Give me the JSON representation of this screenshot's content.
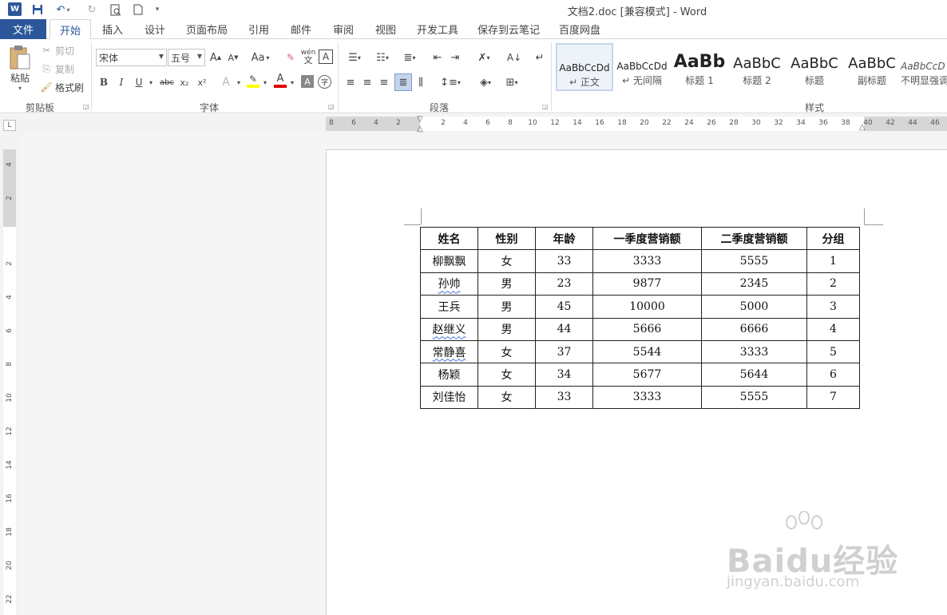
{
  "window": {
    "title": "文档2.doc [兼容模式] - Word",
    "app_logo": "W"
  },
  "quick_access": [
    "save-icon",
    "undo-icon",
    "redo-icon",
    "print-preview-icon",
    "new-doc-icon",
    "customize-icon"
  ],
  "tabs": {
    "file": "文件",
    "items": [
      "开始",
      "插入",
      "设计",
      "页面布局",
      "引用",
      "邮件",
      "审阅",
      "视图",
      "开发工具",
      "保存到云笔记",
      "百度网盘"
    ],
    "active_index": 0
  },
  "clipboard": {
    "paste": "粘贴",
    "cut": "剪切",
    "copy": "复制",
    "format_painter": "格式刷",
    "label": "剪贴板"
  },
  "font": {
    "name": "宋体",
    "size": "五号",
    "grow": "A",
    "shrink": "A",
    "change_case": "Aa",
    "phonetic": "wén",
    "border": "A",
    "bold": "B",
    "italic": "I",
    "underline": "U",
    "strike": "abc",
    "subscript": "x₂",
    "superscript": "x²",
    "effects": "A",
    "font_color": "A",
    "shading": "A",
    "enclose": "字",
    "label": "字体",
    "highlight_color": "#ffff00",
    "font_color_value": "#e00000"
  },
  "paragraph": {
    "label": "段落"
  },
  "styles": {
    "label": "样式",
    "items": [
      {
        "preview": "AaBbCcDd",
        "name": "↵ 正文"
      },
      {
        "preview": "AaBbCcDd",
        "name": "↵ 无间隔"
      },
      {
        "preview": "AaBb",
        "name": "标题 1"
      },
      {
        "preview": "AaBbC",
        "name": "标题 2"
      },
      {
        "preview": "AaBbC",
        "name": "标题"
      },
      {
        "preview": "AaBbC",
        "name": "副标题"
      },
      {
        "preview": "AaBbCcD",
        "name": "不明显强调"
      }
    ]
  },
  "ruler": {
    "corner": "L",
    "h_ticks": [
      "8",
      "6",
      "4",
      "2",
      "2",
      "4",
      "6",
      "8",
      "10",
      "12",
      "14",
      "16",
      "18",
      "20",
      "22",
      "24",
      "26",
      "28",
      "30",
      "32",
      "34",
      "36",
      "38",
      "40",
      "42",
      "44",
      "46"
    ],
    "v_ticks": [
      "4",
      "2",
      "2",
      "4",
      "6",
      "8",
      "10",
      "12",
      "14",
      "16",
      "18",
      "20",
      "22"
    ]
  },
  "table": {
    "headers": [
      "姓名",
      "性别",
      "年龄",
      "一季度营销额",
      "二季度营销额",
      "分组"
    ],
    "rows": [
      [
        "柳飘飘",
        "女",
        "33",
        "3333",
        "5555",
        "1"
      ],
      [
        "孙帅",
        "男",
        "23",
        "9877",
        "2345",
        "2"
      ],
      [
        "王兵",
        "男",
        "45",
        "10000",
        "5000",
        "3"
      ],
      [
        "赵继义",
        "男",
        "44",
        "5666",
        "6666",
        "4"
      ],
      [
        "常静喜",
        "女",
        "37",
        "5544",
        "3333",
        "5"
      ],
      [
        "杨颖",
        "女",
        "34",
        "5677",
        "5644",
        "6"
      ],
      [
        "刘佳怡",
        "女",
        "33",
        "3333",
        "5555",
        "7"
      ]
    ]
  },
  "watermark": {
    "main": "Baidu经验",
    "sub": "jingyan.baidu.com"
  }
}
